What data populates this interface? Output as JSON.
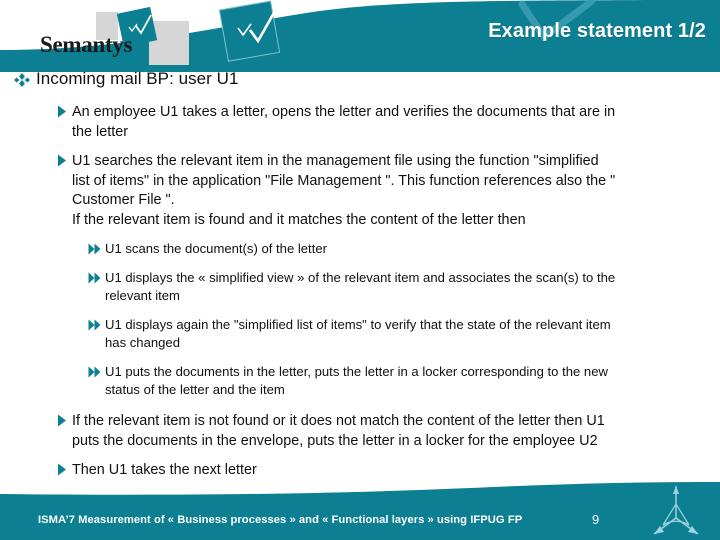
{
  "theme": {
    "teal": "#0d7f93",
    "teal_dark": "#0b7186",
    "teal_light": "#2f9cae",
    "gray_square": "#d6d6d6",
    "text": "#111111",
    "white": "#ffffff"
  },
  "header": {
    "title": "Example statement 1/2",
    "logo_text": "Semantys",
    "logo_icon": "tilted-square-check-icon",
    "watermark_icon": "check-swoosh-icon"
  },
  "content": {
    "heading": {
      "bullet_icon": "diamond-cluster-bullet",
      "text": "Incoming mail BP:  user U1"
    },
    "items": [
      {
        "level": 2,
        "bullet_icon": "triangle-right-bullet",
        "lines": [
          "An employee U1 takes a letter, opens the letter and verifies the documents that are in",
          "the letter"
        ]
      },
      {
        "level": 2,
        "bullet_icon": "triangle-right-bullet",
        "lines": [
          "U1 searches the  relevant item in the management file using the function \"simplified",
          "list of items\" in the application \"File Management \".  This function references also the \"",
          "Customer File \".",
          "If the relevant item is found and it matches the content of the letter then"
        ]
      },
      {
        "level": 3,
        "bullet_icon": "double-arrow-right-bullet",
        "lines": [
          "U1 scans the document(s) of the letter"
        ]
      },
      {
        "level": 3,
        "bullet_icon": "double-arrow-right-bullet",
        "lines": [
          "U1 displays the « simplified view » of the relevant item and associates the scan(s) to the",
          "relevant item"
        ]
      },
      {
        "level": 3,
        "bullet_icon": "double-arrow-right-bullet",
        "lines": [
          "U1 displays again the \"simplified list of items\"  to verify that the state of the relevant item",
          "has changed"
        ]
      },
      {
        "level": 3,
        "bullet_icon": "double-arrow-right-bullet",
        "lines": [
          "U1 puts the documents in the letter, puts the letter in a locker corresponding to the new",
          "status of the letter and  the item"
        ]
      },
      {
        "level": 2,
        "bullet_icon": "triangle-right-bullet",
        "lines": [
          "If the relevant item is not found or it does not match the content of the letter then U1",
          "puts the documents in the envelope, puts the letter in a locker for the employee U2"
        ]
      },
      {
        "level": 2,
        "bullet_icon": "triangle-right-bullet",
        "lines": [
          "Then U1 takes the next letter"
        ]
      }
    ]
  },
  "footer": {
    "text": "ISMA’7   Measurement of « Business processes » and « Functional layers » using  IFPUG  FP",
    "page_number": "9",
    "logo_icon": "three-arrow-star-icon"
  }
}
